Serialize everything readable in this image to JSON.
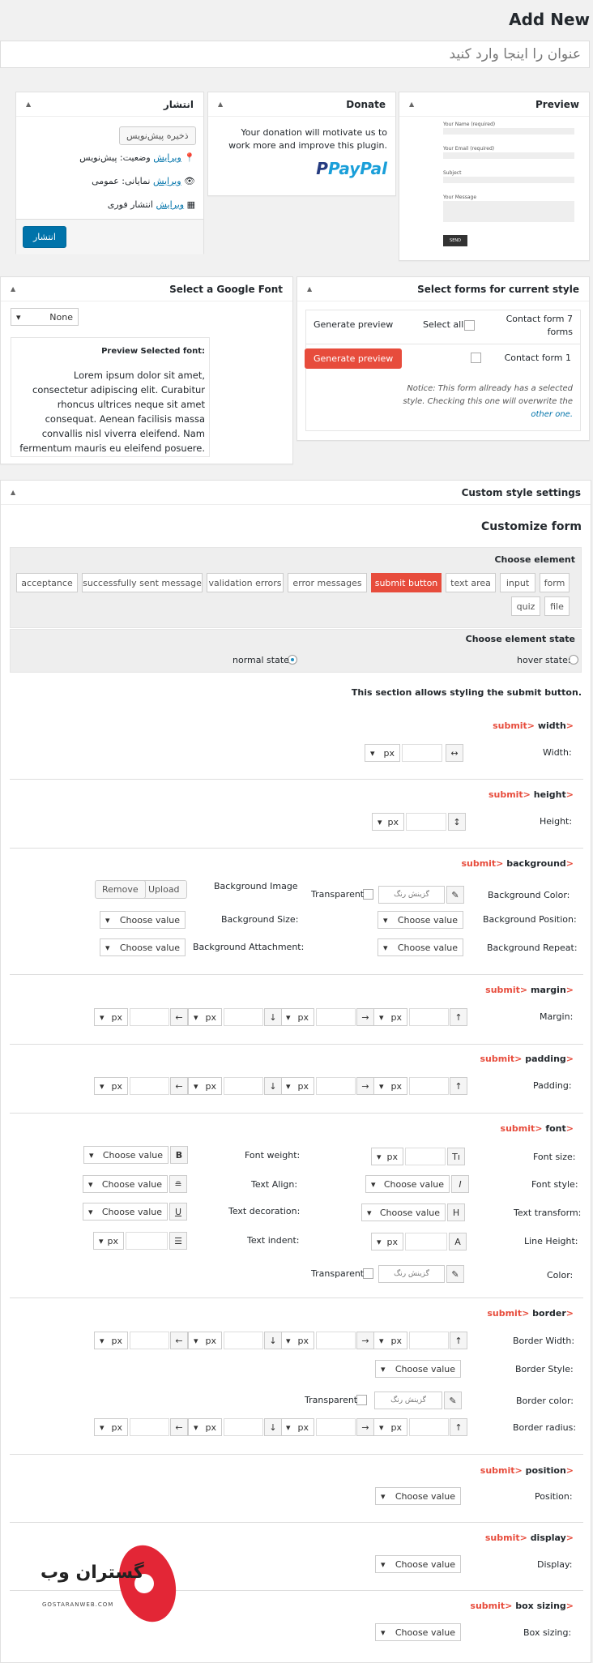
{
  "page_title": "Add New",
  "title_placeholder": "عنوان را اینجا وارد کنید",
  "preview": {
    "title": "Preview",
    "fields": [
      "Your Name (required)",
      "Your Email (required)",
      "Subject",
      "Your Message"
    ],
    "send": "SEND"
  },
  "donate": {
    "title": "Donate",
    "text": "Your donation will motivate us to work more and improve this plugin.",
    "paypal": "PayPal"
  },
  "publish": {
    "title": "انتشار",
    "save_draft": "ذخیره پیش‌نویس",
    "status": "وضعیت: پیش‌نویس",
    "visibility": "نمایانی: عمومی",
    "schedule": "انتشار فوری",
    "edit": "ویرایش",
    "publish_btn": "انتشار"
  },
  "select_forms": {
    "title": "Select forms for current style",
    "col_form": "Contact form 7 forms",
    "select_all": "Select all",
    "gen_preview": "Generate preview",
    "row_form": "Contact form 1",
    "gen_btn": "Generate preview",
    "notice": "Notice: This form allready has a selected style. Checking this one will overwrite the",
    "notice_link": "other one."
  },
  "google_font": {
    "title": "Select a Google Font",
    "select": "None",
    "preview_title": "Preview Selected font:",
    "preview_text": "Lorem ipsum dolor sit amet, consectetur adipiscing elit. Curabitur rhoncus ultrices neque sit amet consequat. Aenean facilisis massa convallis nisl viverra eleifend. Nam fermentum mauris eu eleifend posuere."
  },
  "custom": {
    "title": "Custom style settings",
    "customize": "Customize form",
    "choose_element": "Choose element",
    "elements": [
      "form",
      "input",
      "text area",
      "submit button",
      "error messages",
      "validation errors",
      "successfully sent message",
      "acceptance",
      "file",
      "quiz"
    ],
    "choose_state": "Choose element state",
    "hover": "hover state:",
    "normal": "normal state",
    "section_note": "This section allows styling the submit button.",
    "prefix": "submit>",
    "suffix": ">",
    "sec_width": "width",
    "lbl_width": "Width:",
    "sec_height": "height",
    "lbl_height": "Height:",
    "sec_background": "background",
    "bg_color": "Background Color:",
    "bg_image": "Background Image",
    "upload": "Upload",
    "remove": "Remove",
    "bg_pos": "Background Position:",
    "bg_size": "Background Size:",
    "bg_repeat": "Background Repeat:",
    "bg_attach": "Background Attachment:",
    "transparent": "Transparent",
    "color_pick": "گزینش رنگ",
    "choose": "Choose value",
    "px": "px",
    "sec_margin": "margin",
    "lbl_margin": "Margin:",
    "sec_padding": "padding",
    "lbl_padding": "Padding:",
    "sec_font": "font",
    "font_size": "Font size:",
    "font_weight": "Font weight:",
    "font_style": "Font style:",
    "text_align": "Text Align:",
    "text_transform": "Text transform:",
    "text_decoration": "Text decoration:",
    "line_height": "Line Height:",
    "text_indent": "Text indent:",
    "color": "Color:",
    "sec_border": "border",
    "border_width": "Border Width:",
    "border_style": "Border Style:",
    "border_color": "Border color:",
    "border_radius": "Border radius:",
    "sec_position": "position",
    "lbl_position": "Position:",
    "sec_display": "display",
    "lbl_display": "Display:",
    "sec_boxsizing": "box sizing",
    "lbl_boxsizing": "Box sizing:"
  },
  "watermark": {
    "text": "گستران وب",
    "url": "GOSTARANWEB.COM"
  }
}
